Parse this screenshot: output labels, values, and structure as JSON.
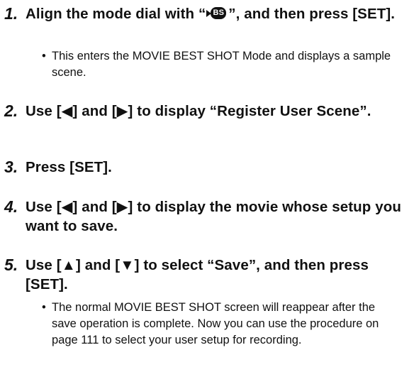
{
  "steps": [
    {
      "number": "1.",
      "heading_before_icon": "Align the mode dial with “",
      "icon_name": "movie-best-shot-icon",
      "icon_text": "BS",
      "heading_after_icon": "”, and then press [SET].",
      "bullet": "This enters the MOVIE BEST SHOT Mode and displays a sample scene."
    },
    {
      "number": "2.",
      "heading": "Use [◀] and [▶] to display “Register User Scene”."
    },
    {
      "number": "3.",
      "heading": "Press [SET]."
    },
    {
      "number": "4.",
      "heading": "Use [◀] and [▶] to display the movie whose setup you want to save."
    },
    {
      "number": "5.",
      "heading": "Use [▲] and [▼] to select “Save”, and then press [SET].",
      "bullet": "The normal MOVIE BEST SHOT screen will reappear after the save operation is complete. Now you can use the procedure on page 111 to select your user setup for recording."
    }
  ],
  "bullet_symbol": "•"
}
